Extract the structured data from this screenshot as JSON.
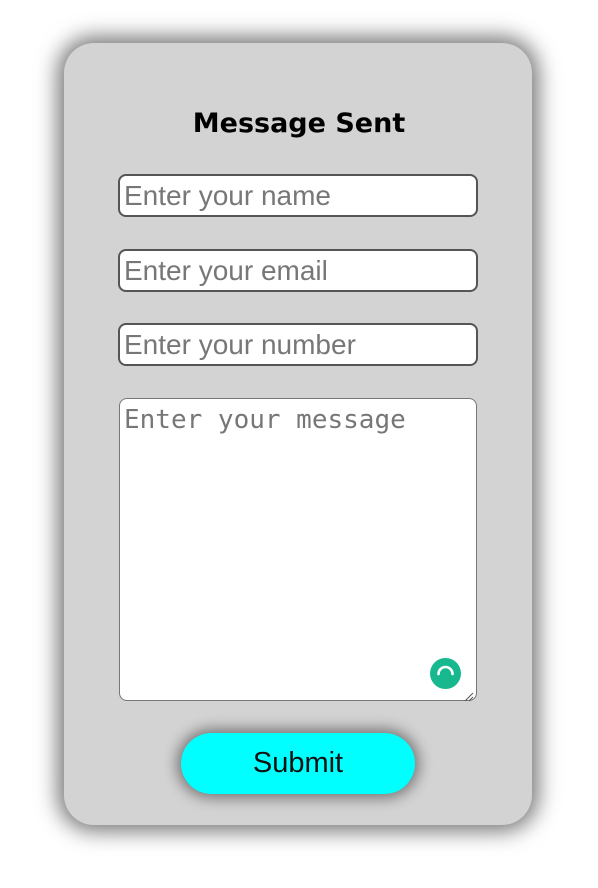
{
  "form": {
    "title": "Message Sent",
    "name_placeholder": "Enter your name",
    "email_placeholder": "Enter your email",
    "number_placeholder": "Enter your number",
    "message_placeholder": "Enter your message",
    "submit_label": "Submit"
  },
  "colors": {
    "card_background": "#d3d3d3",
    "submit_button": "#00ffff",
    "grammar_icon": "#17b88e"
  },
  "icons": {
    "grammar": "grammar-assistant-icon",
    "resize": "resize-handle-icon"
  }
}
